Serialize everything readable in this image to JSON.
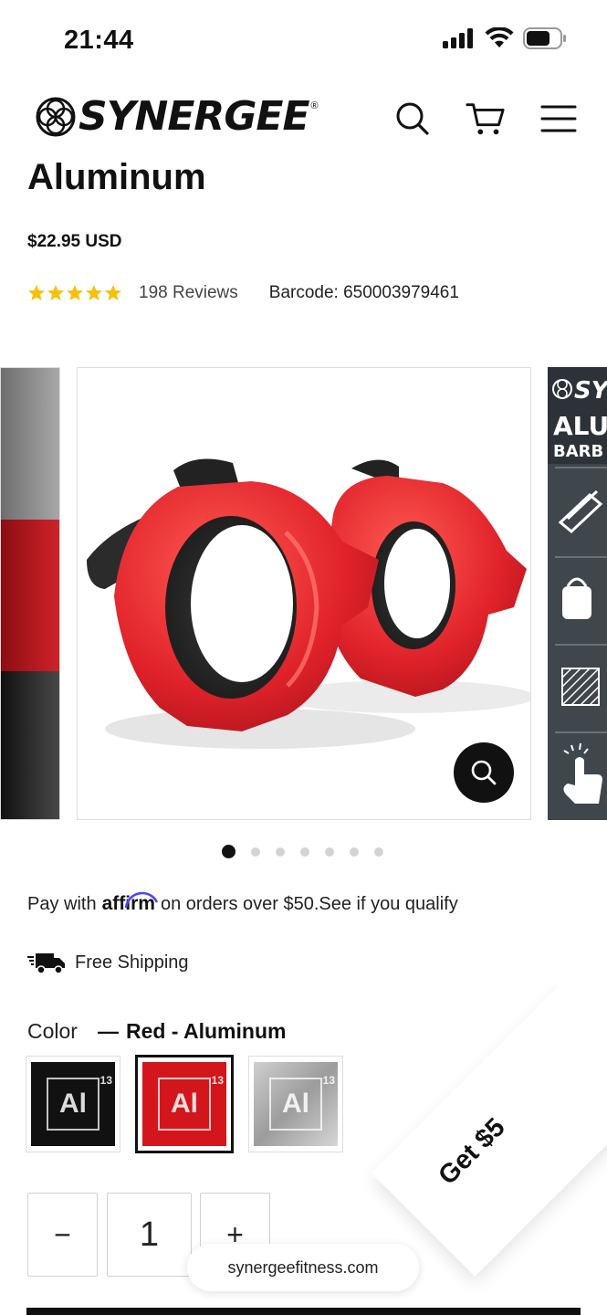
{
  "status": {
    "time": "21:44"
  },
  "header": {
    "brand": "SYNERGEE",
    "reg": "®"
  },
  "product": {
    "title": "Aluminum",
    "price": "$22.95 USD",
    "rating": 5,
    "reviews": "198 Reviews",
    "barcode": "Barcode: 650003979461"
  },
  "gallery": {
    "slide_count": 7,
    "active_index": 0,
    "next_slide": {
      "heading_1": "SY",
      "heading_2": "ALU",
      "heading_3": "BARB"
    }
  },
  "affirm": {
    "prefix": "Pay with",
    "brand": "affirm",
    "suffix": "on orders over $50.",
    "link": "See if you qualify"
  },
  "shipping": {
    "label": "Free Shipping"
  },
  "variant": {
    "label": "Color",
    "dash": "—",
    "selected": "Red - Aluminum",
    "swatches": [
      {
        "symbol": "Al",
        "number": "13",
        "color": "#111111",
        "selected": false
      },
      {
        "symbol": "Al",
        "number": "13",
        "color": "#d3161c",
        "selected": true
      },
      {
        "symbol": "Al",
        "number": "13",
        "color": "#b8b8b8",
        "selected": false
      }
    ]
  },
  "quantity": {
    "minus": "−",
    "value": "1",
    "plus": "+"
  },
  "promo": {
    "label": "Get $5"
  },
  "browser": {
    "url": "synergeefitness.com"
  },
  "colors": {
    "accent_red": "#d3161c",
    "dark": "#111111",
    "affirm_blue": "#4a4af4"
  }
}
